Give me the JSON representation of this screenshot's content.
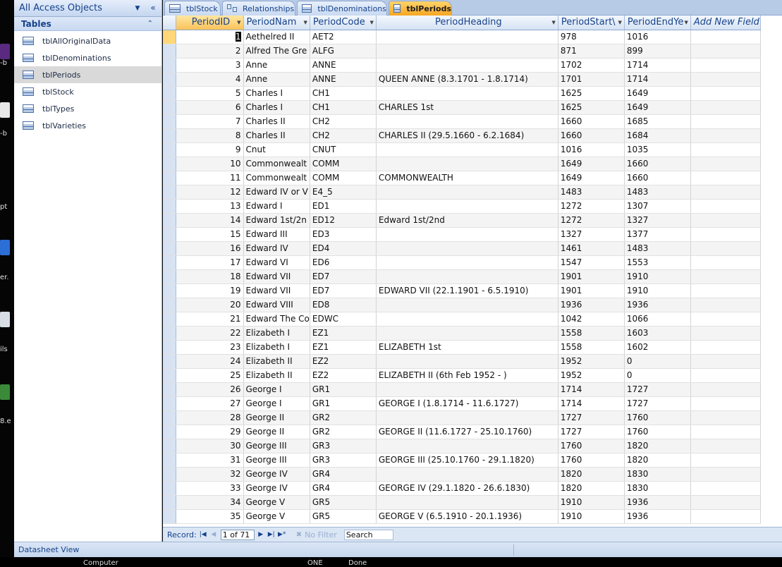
{
  "desktop_strip": {
    "labels": [
      "-b",
      "-b",
      "pt",
      "er.",
      "ils",
      "8.e"
    ]
  },
  "nav": {
    "title": "All Access Objects",
    "menu_icon": "chevron-down-icon",
    "collapse_icon": "double-chevron-left-icon",
    "group_label": "Tables",
    "group_icon": "double-chevron-up-icon",
    "items": [
      {
        "label": "tblAllOriginalData"
      },
      {
        "label": "tblDenominations"
      },
      {
        "label": "tblPeriods"
      },
      {
        "label": "tblStock"
      },
      {
        "label": "tblTypes"
      },
      {
        "label": "tblVarieties"
      }
    ],
    "selected_index": 2
  },
  "tabs": [
    {
      "label": "tblStock",
      "icon": "table-icon"
    },
    {
      "label": "Relationships",
      "icon": "relationships-icon"
    },
    {
      "label": "tblDenominations",
      "icon": "table-icon"
    },
    {
      "label": "tblPeriods",
      "icon": "table-icon",
      "active": true
    }
  ],
  "grid": {
    "columns": [
      "PeriodID",
      "PeriodName",
      "PeriodCode",
      "PeriodHeading",
      "PeriodStartYear",
      "PeriodEndYear",
      "Add New Field"
    ],
    "column_display": [
      "PeriodID",
      "PeriodNam",
      "PeriodCode",
      "PeriodHeading",
      "PeriodStart\\",
      "PeriodEndYe",
      "Add New Field"
    ],
    "current_row_index": 0,
    "rows": [
      [
        "1",
        "Aethelred II",
        "AET2",
        "",
        "978",
        "1016"
      ],
      [
        "2",
        "Alfred The Gre",
        "ALFG",
        "",
        "871",
        "899"
      ],
      [
        "3",
        "Anne",
        "ANNE",
        "",
        "1702",
        "1714"
      ],
      [
        "4",
        "Anne",
        "ANNE",
        "QUEEN ANNE (8.3.1701 - 1.8.1714)",
        "1701",
        "1714"
      ],
      [
        "5",
        "Charles I",
        "CH1",
        "",
        "1625",
        "1649"
      ],
      [
        "6",
        "Charles I",
        "CH1",
        "CHARLES 1st",
        "1625",
        "1649"
      ],
      [
        "7",
        "Charles II",
        "CH2",
        "",
        "1660",
        "1685"
      ],
      [
        "8",
        "Charles II",
        "CH2",
        "CHARLES II (29.5.1660 - 6.2.1684)",
        "1660",
        "1684"
      ],
      [
        "9",
        "Cnut",
        "CNUT",
        "",
        "1016",
        "1035"
      ],
      [
        "10",
        "Commonwealt",
        "COMM",
        "",
        "1649",
        "1660"
      ],
      [
        "11",
        "Commonwealt",
        "COMM",
        "COMMONWEALTH",
        "1649",
        "1660"
      ],
      [
        "12",
        "Edward IV or V",
        "E4_5",
        "",
        "1483",
        "1483"
      ],
      [
        "13",
        "Edward I",
        "ED1",
        "",
        "1272",
        "1307"
      ],
      [
        "14",
        "Edward 1st/2n",
        "ED12",
        "Edward 1st/2nd",
        "1272",
        "1327"
      ],
      [
        "15",
        "Edward III",
        "ED3",
        "",
        "1327",
        "1377"
      ],
      [
        "16",
        "Edward IV",
        "ED4",
        "",
        "1461",
        "1483"
      ],
      [
        "17",
        "Edward VI",
        "ED6",
        "",
        "1547",
        "1553"
      ],
      [
        "18",
        "Edward VII",
        "ED7",
        "",
        "1901",
        "1910"
      ],
      [
        "19",
        "Edward VII",
        "ED7",
        "EDWARD VII (22.1.1901 - 6.5.1910)",
        "1901",
        "1910"
      ],
      [
        "20",
        "Edward VIII",
        "ED8",
        "",
        "1936",
        "1936"
      ],
      [
        "21",
        "Edward The Co",
        "EDWC",
        "",
        "1042",
        "1066"
      ],
      [
        "22",
        "Elizabeth I",
        "EZ1",
        "",
        "1558",
        "1603"
      ],
      [
        "23",
        "Elizabeth I",
        "EZ1",
        "ELIZABETH 1st",
        "1558",
        "1602"
      ],
      [
        "24",
        "Elizabeth II",
        "EZ2",
        "",
        "1952",
        "0"
      ],
      [
        "25",
        "Elizabeth II",
        "EZ2",
        "ELIZABETH II (6th Feb 1952 -  )",
        "1952",
        "0"
      ],
      [
        "26",
        "George I",
        "GR1",
        "",
        "1714",
        "1727"
      ],
      [
        "27",
        "George I",
        "GR1",
        "GEORGE I (1.8.1714 - 11.6.1727)",
        "1714",
        "1727"
      ],
      [
        "28",
        "George II",
        "GR2",
        "",
        "1727",
        "1760"
      ],
      [
        "29",
        "George II",
        "GR2",
        "GEORGE II (11.6.1727 - 25.10.1760)",
        "1727",
        "1760"
      ],
      [
        "30",
        "George III",
        "GR3",
        "",
        "1760",
        "1820"
      ],
      [
        "31",
        "George III",
        "GR3",
        "GEORGE III (25.10.1760 - 29.1.1820)",
        "1760",
        "1820"
      ],
      [
        "32",
        "George IV",
        "GR4",
        "",
        "1820",
        "1830"
      ],
      [
        "33",
        "George IV",
        "GR4",
        "GEORGE IV (29.1.1820 - 26.6.1830)",
        "1820",
        "1830"
      ],
      [
        "34",
        "George V",
        "GR5",
        "",
        "1910",
        "1936"
      ],
      [
        "35",
        "George V",
        "GR5",
        "GEORGE V (6.5.1910 - 20.1.1936)",
        "1910",
        "1936"
      ]
    ]
  },
  "record_nav": {
    "label": "Record:",
    "current": "1 of 71",
    "filter_label": "No Filter",
    "search_label": "Search"
  },
  "status": {
    "text": "Datasheet View"
  },
  "taskbar": {
    "left_text": "Computer",
    "mid_text": "ONE",
    "right_text": "Done"
  }
}
